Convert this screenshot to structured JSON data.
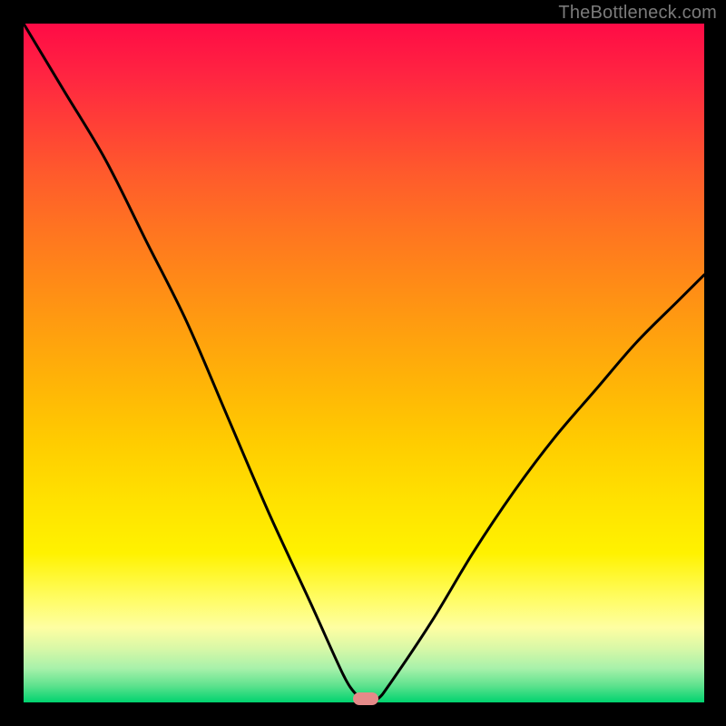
{
  "attribution": "TheBottleneck.com",
  "chart_data": {
    "type": "line",
    "title": "",
    "xlabel": "",
    "ylabel": "",
    "xlim": [
      0,
      100
    ],
    "ylim": [
      0,
      100
    ],
    "grid": false,
    "legend": false,
    "note": "Bottleneck/mismatch curve with rainbow gradient background (red=high mismatch at top, green=low at bottom); a single dip to ~0 marks the balanced point.",
    "x": [
      0,
      6,
      12,
      18,
      24,
      30,
      36,
      42,
      47,
      49,
      50,
      52,
      54,
      60,
      66,
      72,
      78,
      84,
      90,
      96,
      100
    ],
    "y_values": [
      100,
      90,
      80,
      68,
      56,
      42,
      28,
      15,
      4,
      1,
      0,
      0.5,
      3,
      12,
      22,
      31,
      39,
      46,
      53,
      59,
      63
    ],
    "marker": {
      "x": 50.3,
      "y": 0.5
    },
    "gradient_stops": [
      {
        "pct": 0,
        "color": "#ff0b46"
      },
      {
        "pct": 50,
        "color": "#ffa500"
      },
      {
        "pct": 80,
        "color": "#ffff00"
      },
      {
        "pct": 100,
        "color": "#00d36f"
      }
    ]
  }
}
